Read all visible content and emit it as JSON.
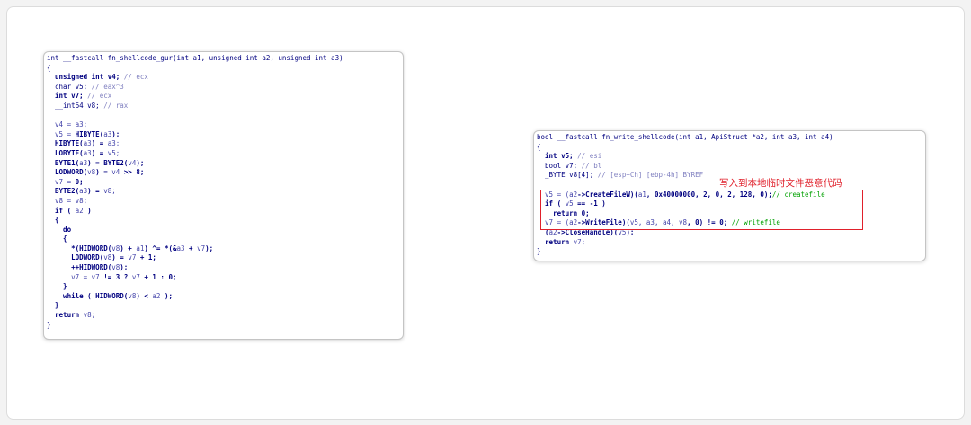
{
  "colors": {
    "keyword": "#000080",
    "variable": "#4444aa",
    "number": "#008000",
    "comment": "#8080c0",
    "comment_green": "#00a000",
    "highlight": "#e0202b"
  },
  "left_panel": {
    "lines": [
      [
        {
          "t": "int __fastcall fn_shellcode_gur(int a1, unsigned int a2, unsigned int a3)",
          "c": "kw"
        }
      ],
      [
        {
          "t": "{",
          "c": "kw"
        }
      ],
      [
        {
          "t": "  unsigned int v4; ",
          "c": "bold"
        },
        {
          "t": "// ecx",
          "c": "cm"
        }
      ],
      [
        {
          "t": "  char v5; ",
          "c": "kw"
        },
        {
          "t": "// eax^3",
          "c": "cm"
        }
      ],
      [
        {
          "t": "  int v7; ",
          "c": "bold"
        },
        {
          "t": "// ecx",
          "c": "cm"
        }
      ],
      [
        {
          "t": "  __int64 v8; ",
          "c": "kw"
        },
        {
          "t": "// rax",
          "c": "cm"
        }
      ],
      [
        {
          "t": "",
          "c": "kw"
        }
      ],
      [
        {
          "t": "  v4 = a3;",
          "c": "var"
        }
      ],
      [
        {
          "t": "  v5 = ",
          "c": "var"
        },
        {
          "t": "HIBYTE(",
          "c": "bold"
        },
        {
          "t": "a3",
          "c": "var"
        },
        {
          "t": ");",
          "c": "bold"
        }
      ],
      [
        {
          "t": "  HIBYTE(",
          "c": "bold"
        },
        {
          "t": "a3",
          "c": "var"
        },
        {
          "t": ") = ",
          "c": "bold"
        },
        {
          "t": "a3;",
          "c": "var"
        }
      ],
      [
        {
          "t": "  LOBYTE(",
          "c": "bold"
        },
        {
          "t": "a3",
          "c": "var"
        },
        {
          "t": ") = ",
          "c": "bold"
        },
        {
          "t": "v5;",
          "c": "var"
        }
      ],
      [
        {
          "t": "  BYTE1(",
          "c": "bold"
        },
        {
          "t": "a3",
          "c": "var"
        },
        {
          "t": ") = BYTE2(",
          "c": "bold"
        },
        {
          "t": "v4",
          "c": "var"
        },
        {
          "t": ");",
          "c": "bold"
        }
      ],
      [
        {
          "t": "  LODWORD(",
          "c": "bold"
        },
        {
          "t": "v8",
          "c": "var"
        },
        {
          "t": ") = ",
          "c": "bold"
        },
        {
          "t": "v4 ",
          "c": "var"
        },
        {
          "t": ">> 8;",
          "c": "bold"
        }
      ],
      [
        {
          "t": "  v7 = ",
          "c": "var"
        },
        {
          "t": "0;",
          "c": "bold"
        }
      ],
      [
        {
          "t": "  BYTE2(",
          "c": "bold"
        },
        {
          "t": "a3",
          "c": "var"
        },
        {
          "t": ") = ",
          "c": "bold"
        },
        {
          "t": "v8;",
          "c": "var"
        }
      ],
      [
        {
          "t": "  v8 = v8;",
          "c": "var"
        }
      ],
      [
        {
          "t": "  if ( ",
          "c": "bold"
        },
        {
          "t": "a2 ",
          "c": "var"
        },
        {
          "t": ")",
          "c": "bold"
        }
      ],
      [
        {
          "t": "  {",
          "c": "bold"
        }
      ],
      [
        {
          "t": "    do",
          "c": "bold"
        }
      ],
      [
        {
          "t": "    {",
          "c": "bold"
        }
      ],
      [
        {
          "t": "      *(HIDWORD(",
          "c": "bold"
        },
        {
          "t": "v8",
          "c": "var"
        },
        {
          "t": ") + ",
          "c": "bold"
        },
        {
          "t": "a1",
          "c": "var"
        },
        {
          "t": ") ^= *(&",
          "c": "bold"
        },
        {
          "t": "a3 ",
          "c": "var"
        },
        {
          "t": "+ ",
          "c": "bold"
        },
        {
          "t": "v7",
          "c": "var"
        },
        {
          "t": ");",
          "c": "bold"
        }
      ],
      [
        {
          "t": "      LODWORD(",
          "c": "bold"
        },
        {
          "t": "v8",
          "c": "var"
        },
        {
          "t": ") = ",
          "c": "bold"
        },
        {
          "t": "v7 ",
          "c": "var"
        },
        {
          "t": "+ 1;",
          "c": "bold"
        }
      ],
      [
        {
          "t": "      ++HIDWORD(",
          "c": "bold"
        },
        {
          "t": "v8",
          "c": "var"
        },
        {
          "t": ");",
          "c": "bold"
        }
      ],
      [
        {
          "t": "      v7 = v7 ",
          "c": "var"
        },
        {
          "t": "!= 3 ? ",
          "c": "bold"
        },
        {
          "t": "v7 ",
          "c": "var"
        },
        {
          "t": "+ 1 : 0;",
          "c": "bold"
        }
      ],
      [
        {
          "t": "    }",
          "c": "bold"
        }
      ],
      [
        {
          "t": "    while ( HIDWORD(",
          "c": "bold"
        },
        {
          "t": "v8",
          "c": "var"
        },
        {
          "t": ") < ",
          "c": "bold"
        },
        {
          "t": "a2 ",
          "c": "var"
        },
        {
          "t": ");",
          "c": "bold"
        }
      ],
      [
        {
          "t": "  }",
          "c": "bold"
        }
      ],
      [
        {
          "t": "  return ",
          "c": "bold"
        },
        {
          "t": "v8;",
          "c": "var"
        }
      ],
      [
        {
          "t": "}",
          "c": "kw"
        }
      ]
    ]
  },
  "right_panel": {
    "lines": [
      [
        {
          "t": "bool __fastcall fn_write_shellcode(int a1, ApiStruct *a2, int a3, int a4)",
          "c": "kw"
        }
      ],
      [
        {
          "t": "{",
          "c": "kw"
        }
      ],
      [
        {
          "t": "  int v5; ",
          "c": "bold"
        },
        {
          "t": "// esi",
          "c": "cm"
        }
      ],
      [
        {
          "t": "  bool v7; ",
          "c": "kw"
        },
        {
          "t": "// bl",
          "c": "cm"
        }
      ],
      [
        {
          "t": "  _BYTE v8[4]; ",
          "c": "kw"
        },
        {
          "t": "// [esp+Ch] [ebp-4h] BYREF",
          "c": "cm"
        }
      ],
      [
        {
          "t": "",
          "c": "kw"
        }
      ],
      [
        {
          "t": "  v5 = (",
          "c": "var"
        },
        {
          "t": "a2",
          "c": "var"
        },
        {
          "t": "->CreateFileW)(",
          "c": "bold"
        },
        {
          "t": "a1",
          "c": "var"
        },
        {
          "t": ", 0x40000000, 2, 0, 2, 128, 0);",
          "c": "bold"
        },
        {
          "t": "// createfile",
          "c": "cmg"
        }
      ],
      [
        {
          "t": "  if ( ",
          "c": "bold"
        },
        {
          "t": "v5 ",
          "c": "var"
        },
        {
          "t": "== -1 )",
          "c": "bold"
        }
      ],
      [
        {
          "t": "    return 0;",
          "c": "bold"
        }
      ],
      [
        {
          "t": "  v7 = (",
          "c": "var"
        },
        {
          "t": "a2",
          "c": "var"
        },
        {
          "t": "->WriteFile)(",
          "c": "bold"
        },
        {
          "t": "v5, a3, a4, v8",
          "c": "var"
        },
        {
          "t": ", 0) != 0; ",
          "c": "bold"
        },
        {
          "t": "// writefile",
          "c": "cmg"
        }
      ],
      [
        {
          "t": "  (",
          "c": "bold"
        },
        {
          "t": "a2",
          "c": "var"
        },
        {
          "t": "->CloseHandle)(",
          "c": "bold"
        },
        {
          "t": "v5",
          "c": "var"
        },
        {
          "t": ");",
          "c": "bold"
        }
      ],
      [
        {
          "t": "  return ",
          "c": "bold"
        },
        {
          "t": "v7;",
          "c": "var"
        }
      ],
      [
        {
          "t": "}",
          "c": "kw"
        }
      ]
    ],
    "annotation": "写入到本地临时文件恶意代码"
  }
}
